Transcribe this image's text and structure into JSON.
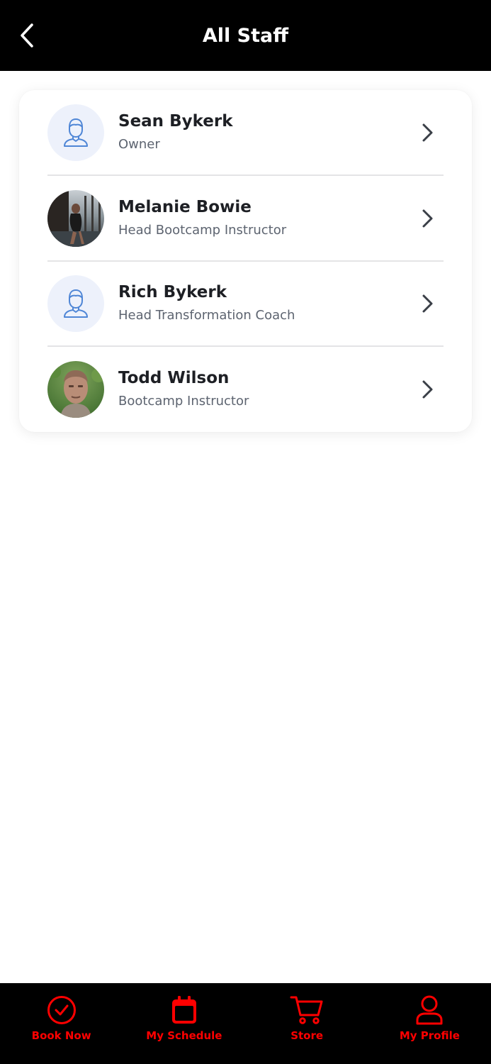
{
  "header": {
    "title": "All Staff",
    "back_icon": "chevron-left-icon"
  },
  "staff": [
    {
      "name": "Sean Bykerk",
      "role": "Owner",
      "avatar": "placeholder"
    },
    {
      "name": "Melanie Bowie",
      "role": "Head Bootcamp Instructor",
      "avatar": "photo"
    },
    {
      "name": "Rich Bykerk",
      "role": "Head Transformation Coach",
      "avatar": "placeholder"
    },
    {
      "name": "Todd Wilson",
      "role": "Bootcamp Instructor",
      "avatar": "photo"
    }
  ],
  "bottom_nav": [
    {
      "label": "Book Now",
      "icon": "check-circle-icon"
    },
    {
      "label": "My Schedule",
      "icon": "calendar-icon"
    },
    {
      "label": "Store",
      "icon": "cart-icon"
    },
    {
      "label": "My Profile",
      "icon": "user-icon"
    }
  ],
  "colors": {
    "header_bg": "#000000",
    "nav_accent": "#ff0000",
    "placeholder_bg": "#edf1fb",
    "placeholder_icon": "#4f86d6"
  }
}
